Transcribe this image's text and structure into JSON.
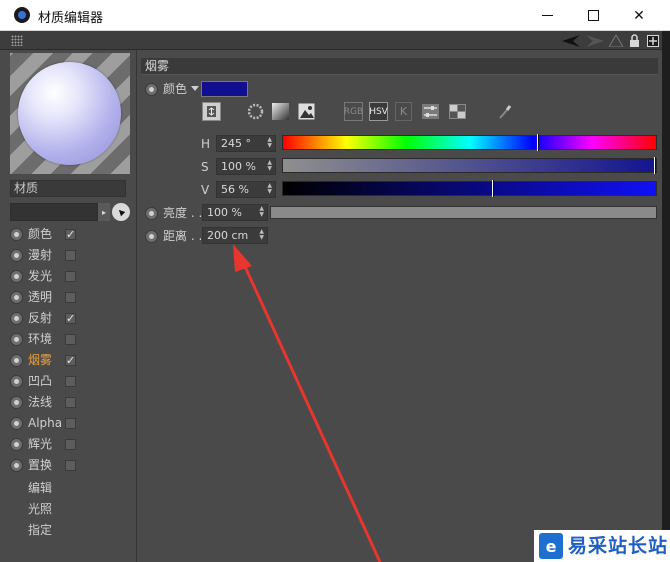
{
  "window": {
    "title": "材质编辑器",
    "controls": {
      "minimize": "minimize-icon",
      "maximize": "maximize-icon",
      "close": "close-icon"
    }
  },
  "toolbar": {
    "icons": [
      "grip-icon",
      "arrow-left-icon",
      "arrow-right-icon",
      "lock-icon",
      "new-panel-icon"
    ]
  },
  "material": {
    "name": "材质",
    "preview": "sphere-preview"
  },
  "channels": [
    {
      "label": "颜色",
      "checked": true,
      "active": false
    },
    {
      "label": "漫射",
      "checked": false,
      "active": false
    },
    {
      "label": "发光",
      "checked": false,
      "active": false
    },
    {
      "label": "透明",
      "checked": false,
      "active": false
    },
    {
      "label": "反射",
      "checked": true,
      "active": false
    },
    {
      "label": "环境",
      "checked": false,
      "active": false
    },
    {
      "label": "烟雾",
      "checked": true,
      "active": true
    },
    {
      "label": "凹凸",
      "checked": false,
      "active": false
    },
    {
      "label": "法线",
      "checked": false,
      "active": false
    },
    {
      "label": "Alpha",
      "checked": false,
      "active": false
    },
    {
      "label": "辉光",
      "checked": false,
      "active": false
    },
    {
      "label": "置换",
      "checked": false,
      "active": false
    }
  ],
  "sub_items": [
    "编辑",
    "光照",
    "指定"
  ],
  "fog": {
    "section_title": "烟雾",
    "color_label": "颜色",
    "color_hex": "#110e8f",
    "tools": [
      "RGB",
      "HSV",
      "K"
    ],
    "hue": {
      "label": "H",
      "value": "245 °",
      "fraction": 0.68
    },
    "saturation": {
      "label": "S",
      "value": "100 %",
      "fraction": 1.0
    },
    "value": {
      "label": "V",
      "value": "56 %",
      "fraction": 0.56
    },
    "brightness": {
      "label": "亮度 . .",
      "value": "100 %"
    },
    "distance": {
      "label": "距离 . .",
      "value": "200 cm"
    }
  },
  "watermark": {
    "text": "易采站长站"
  }
}
